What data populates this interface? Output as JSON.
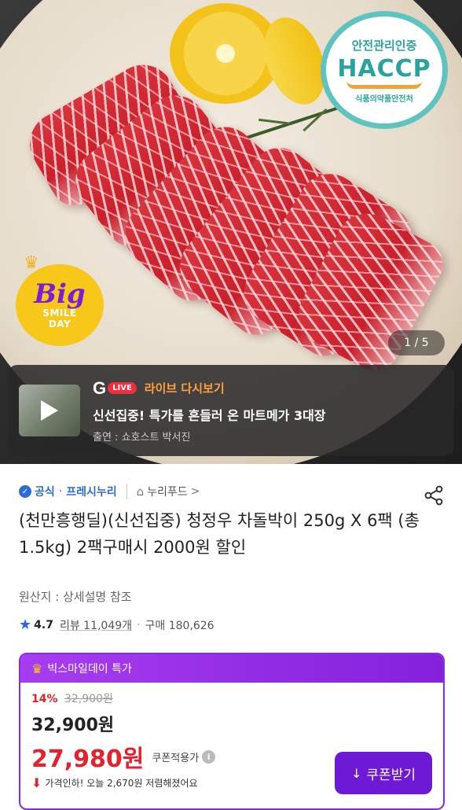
{
  "hero": {
    "haccp_top": "안전관리인증",
    "haccp_main": "HACCP",
    "haccp_bottom": "식품의약품안전처",
    "badge_big": "Big",
    "badge_smile": "SMILE",
    "badge_day": "DAY",
    "counter": "1 / 5"
  },
  "live": {
    "g_logo": "G",
    "live_badge": "LIVE",
    "label": "라이브 다시보기",
    "title": "신선집중! 특가를 흔들러 온 마트메가 3대장",
    "cast": "출연 : 쇼호스트 박서진"
  },
  "store": {
    "official": "공식",
    "seller": "프레시누리",
    "brand": "누리푸드",
    "chevron": ">"
  },
  "product": {
    "title": "(천만흥행딜)(신선집중) 청정우 차돌박이 250g X 6팩 (총 1.5kg) 2팩구매시 2000원 할인",
    "origin": "원산지 : 상세설명 참조",
    "rating": "4.7",
    "reviews": "리뷰 11,049개",
    "purchases": "구매 180,626"
  },
  "deal": {
    "header": "빅스마일데이 특가",
    "percent": "14%",
    "original": "32,900원",
    "price": "32,900원",
    "sale_price": "27,980원",
    "coupon_label": "쿠폰적용가",
    "drop_text": "가격인하! 오늘 2,670원 저렴해졌어요",
    "coupon_button": "쿠폰받기"
  },
  "colors": {
    "accent_purple": "#8421dc",
    "sale_red": "#e8202b",
    "official_blue": "#2d6bd8"
  }
}
